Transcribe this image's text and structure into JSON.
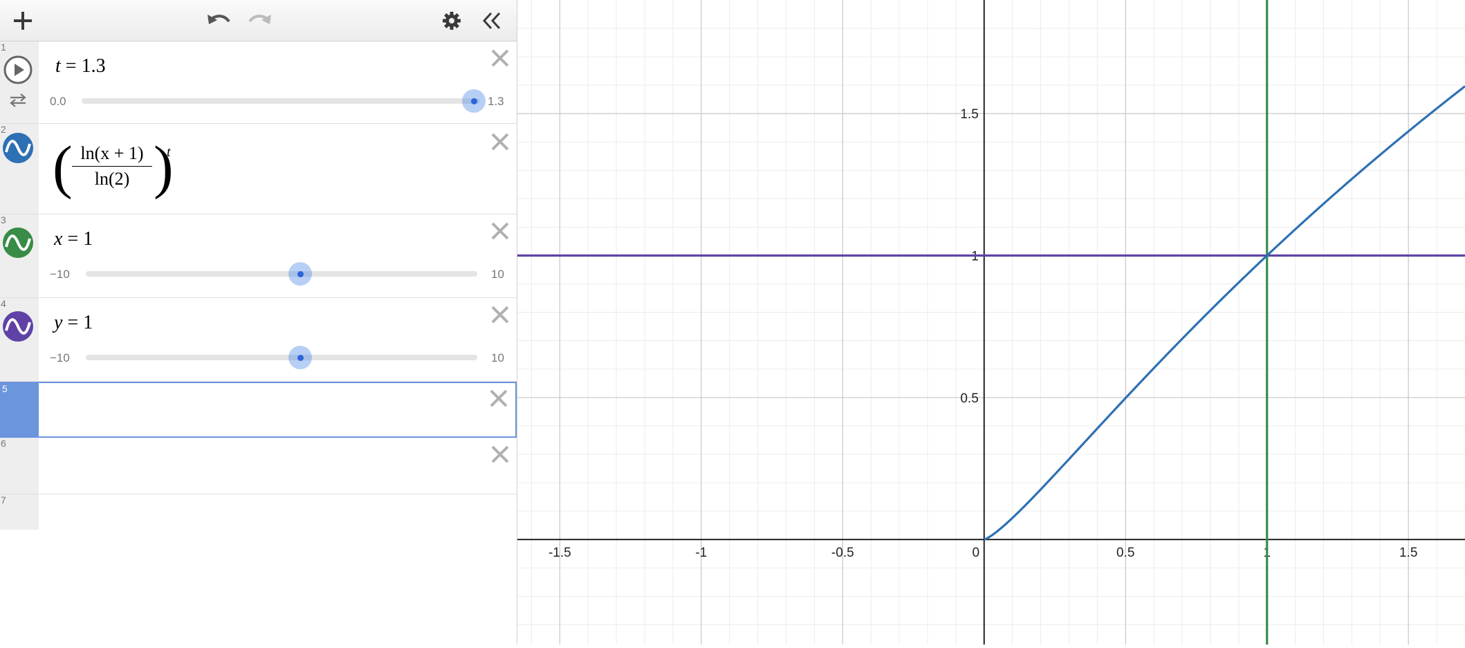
{
  "toolbar": {
    "add": "add-icon",
    "undo": "undo-icon",
    "redo": "redo-icon",
    "settings": "gear-icon",
    "collapse": "double-chevron-left-icon"
  },
  "expressions": [
    {
      "index": "1",
      "kind": "slider",
      "icon": "play-icon",
      "secondary_icon": "loop-icon",
      "variable": "t",
      "equals": " = ",
      "value": "1.3",
      "min": "0.0",
      "max": "1.3",
      "position_fraction": 1.0
    },
    {
      "index": "2",
      "kind": "function",
      "color": "#2d70b3",
      "icon": "graph-wave-icon",
      "numerator": "ln(x + 1)",
      "denominator": "ln(2)",
      "exponent": "t"
    },
    {
      "index": "3",
      "kind": "slider",
      "color": "#388c46",
      "icon": "graph-wave-icon",
      "variable": "x",
      "equals": " = ",
      "value": "1",
      "min": "−10",
      "max": "10",
      "position_fraction": 0.55
    },
    {
      "index": "4",
      "kind": "slider",
      "color": "#6042a6",
      "icon": "graph-wave-icon",
      "variable": "y",
      "equals": " = ",
      "value": "1",
      "min": "−10",
      "max": "10",
      "position_fraction": 0.55
    },
    {
      "index": "5",
      "kind": "empty",
      "focused": true
    },
    {
      "index": "6",
      "kind": "empty"
    },
    {
      "index": "7",
      "kind": "empty"
    }
  ],
  "delete_icon": "close-icon",
  "graph": {
    "x_ticks": [
      "-1.5",
      "-1",
      "-0.5",
      "0",
      "0.5",
      "1",
      "1.5"
    ],
    "y_ticks": [
      "0.5",
      "1",
      "1.5"
    ],
    "x_range": [
      -1.65,
      1.7
    ],
    "y_range": [
      -0.37,
      1.9
    ],
    "t": 1.3,
    "vertical_line_x": 1,
    "horizontal_line_y": 1,
    "curve_color": "#2d70b3",
    "vertical_color": "#388c46",
    "horizontal_color": "#6042a6"
  }
}
